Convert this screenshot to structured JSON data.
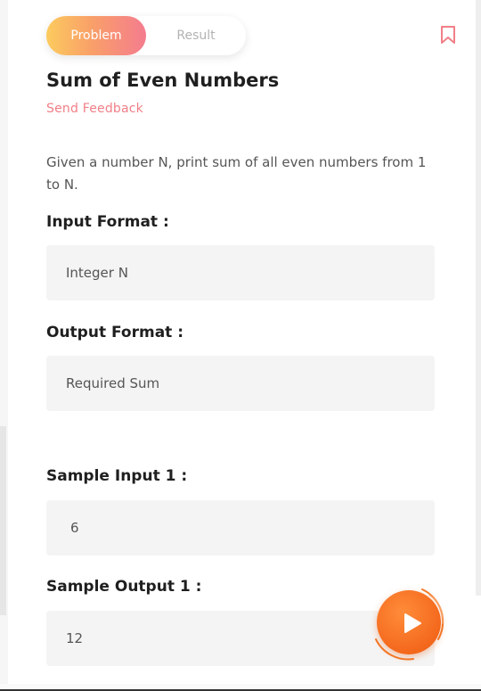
{
  "tabs": {
    "problem": "Problem",
    "result": "Result"
  },
  "problem": {
    "title": "Sum of Even Numbers",
    "feedback_link": "Send Feedback",
    "description": "Given a number N, print sum of all even numbers from 1 to N."
  },
  "sections": {
    "input_format_label": "Input Format :",
    "input_format_value": "Integer N",
    "output_format_label": "Output Format :",
    "output_format_value": "Required Sum",
    "sample_input_label": "Sample Input 1 :",
    "sample_input_value": "6",
    "sample_output_label": "Sample Output 1 :",
    "sample_output_value": "12"
  },
  "icons": {
    "bookmark": "bookmark-icon",
    "run": "play-icon"
  },
  "colors": {
    "tab_gradient_start": "#fccb5e",
    "tab_gradient_end": "#f47c8e",
    "feedback": "#f17f87",
    "run_button": "#f4681c",
    "bookmark": "#f17f87"
  }
}
